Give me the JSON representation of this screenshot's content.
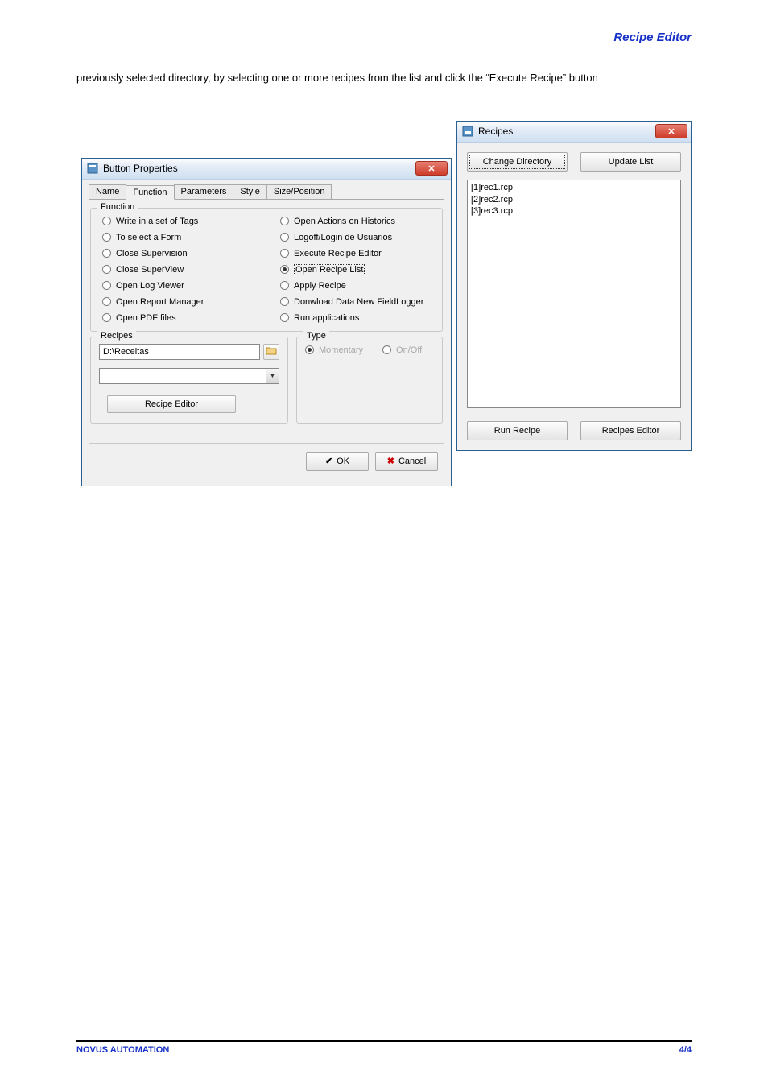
{
  "header": {
    "title": "Recipe Editor"
  },
  "intro": "previously selected directory, by selecting one or more recipes from the list and click the “Execute Recipe” button",
  "bp": {
    "title": "Button Properties",
    "tabs": [
      "Name",
      "Function",
      "Parameters",
      "Style",
      "Size/Position"
    ],
    "active_tab": 1,
    "function_group": "Function",
    "functions_left": [
      "Write in a set of Tags",
      "To select a Form",
      "Close Supervision",
      "Close SuperView",
      "Open Log Viewer",
      "Open Report Manager",
      "Open PDF files"
    ],
    "functions_right": [
      "Open Actions on Historics",
      "Logoff/Login de Usuarios",
      "Execute Recipe Editor",
      "Open Recipe List",
      "Apply Recipe",
      "Donwload Data New FieldLogger",
      "Run applications"
    ],
    "selected_function": "Open Recipe List",
    "recipes_group": "Recipes",
    "recipes_path": "D:\\Receitas",
    "recipe_editor_btn": "Recipe Editor",
    "type_group": "Type",
    "type_momentary": "Momentary",
    "type_onoff": "On/Off",
    "ok": "OK",
    "cancel": "Cancel"
  },
  "rc": {
    "title": "Recipes",
    "change_dir": "Change Directory",
    "update_list": "Update List",
    "items": [
      "[1]rec1.rcp",
      "[2]rec2.rcp",
      "[3]rec3.rcp"
    ],
    "run_recipe": "Run Recipe",
    "recipes_editor": "Recipes Editor"
  },
  "footer": {
    "left": "NOVUS AUTOMATION",
    "right": "4/4"
  }
}
